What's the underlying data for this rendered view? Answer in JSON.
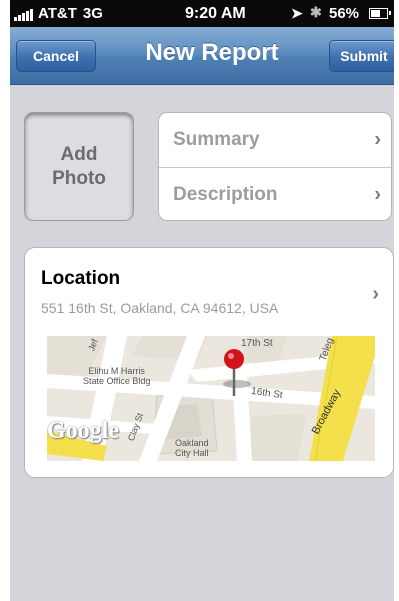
{
  "status_bar": {
    "carrier": "AT&T",
    "network": "3G",
    "time": "9:20 AM",
    "battery_percent": "56%"
  },
  "nav": {
    "cancel_label": "Cancel",
    "title": "New Report",
    "submit_label": "Submit"
  },
  "photo": {
    "label_line1": "Add",
    "label_line2": "Photo"
  },
  "fields": [
    {
      "label": "Summary"
    },
    {
      "label": "Description"
    }
  ],
  "location": {
    "title": "Location",
    "address": "551 16th St, Oakland, CA 94612, USA",
    "map": {
      "labels": {
        "street_17th": "17th St",
        "street_16th": "16th St",
        "telegraph": "Teleg",
        "broadway": "Broadway",
        "jefferson": "Jef",
        "clay": "Clay St",
        "elihu_line1": "Elihu M Harris",
        "elihu_line2": "State Office Bldg",
        "city_hall_line1": "Oakland",
        "city_hall_line2": "City Hall",
        "google": "Google"
      }
    }
  },
  "icons": {
    "chevron": "chevron-right-icon",
    "pin": "map-pin-icon"
  },
  "colors": {
    "nav_blue": "#4f80b6",
    "background": "#d3d5db",
    "pin_red": "#d0141a",
    "road_yellow": "#f4e04a"
  }
}
